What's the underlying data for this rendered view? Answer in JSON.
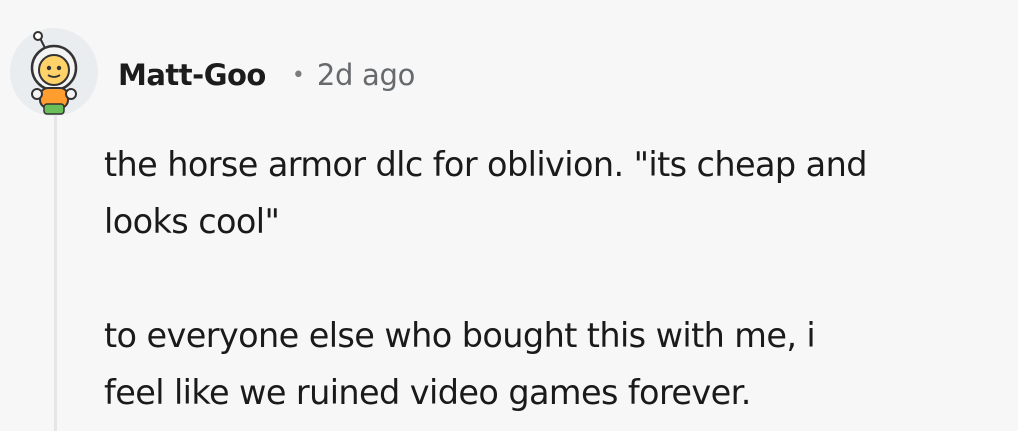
{
  "comment": {
    "author": "Matt-Goo",
    "separator": "•",
    "timestamp": "2d ago",
    "avatar_icon": "snoo-avatar-icon",
    "paragraphs": [
      "the horse armor dlc for oblivion. \"its cheap and\nlooks cool\"",
      "to everyone else who bought this with me, i\nfeel like we ruined video games forever."
    ]
  },
  "colors": {
    "background": "#f7f7f7",
    "text": "#1a1a1b",
    "meta": "#666a6d",
    "thread_line": "#e6e6e6"
  }
}
